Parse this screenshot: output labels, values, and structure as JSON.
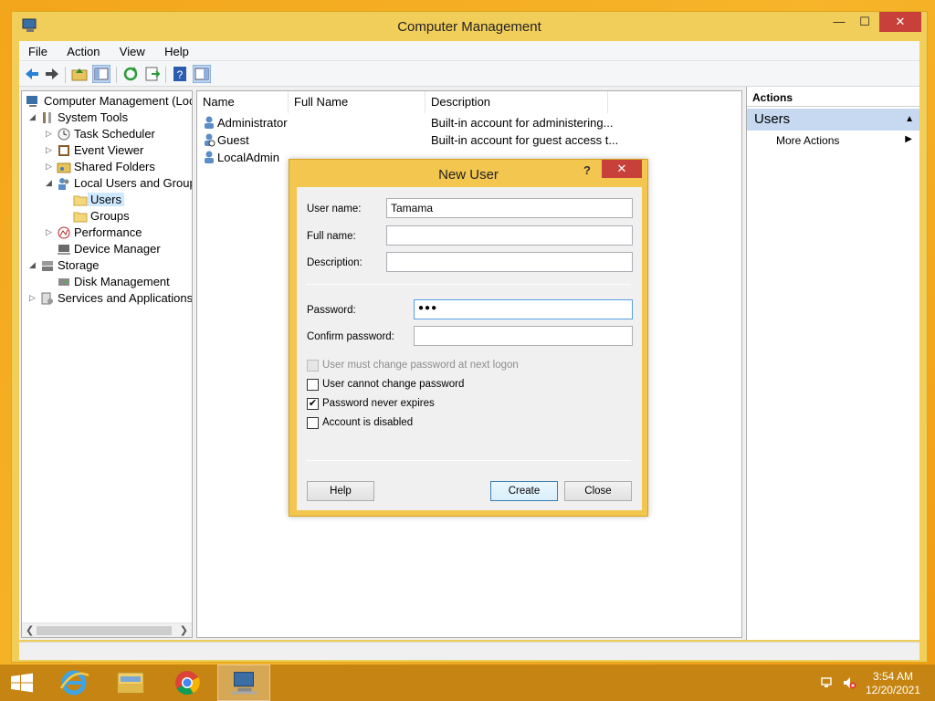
{
  "window": {
    "title": "Computer Management",
    "min": "—",
    "max": "☐",
    "close": "✕"
  },
  "menu": [
    "File",
    "Action",
    "View",
    "Help"
  ],
  "tree": [
    {
      "label": "Computer Management (Local",
      "arrow": "",
      "icon": "computer-management-icon"
    },
    {
      "label": "System Tools",
      "arrow": "◢",
      "icon": "tools-icon"
    },
    {
      "label": "Task Scheduler",
      "arrow": "▷",
      "icon": "clock-icon"
    },
    {
      "label": "Event Viewer",
      "arrow": "▷",
      "icon": "event-viewer-icon"
    },
    {
      "label": "Shared Folders",
      "arrow": "▷",
      "icon": "shared-folder-icon"
    },
    {
      "label": "Local Users and Groups",
      "arrow": "◢",
      "icon": "users-groups-icon"
    },
    {
      "label": "Users",
      "arrow": "",
      "icon": "folder-icon"
    },
    {
      "label": "Groups",
      "arrow": "",
      "icon": "folder-icon"
    },
    {
      "label": "Performance",
      "arrow": "▷",
      "icon": "performance-icon"
    },
    {
      "label": "Device Manager",
      "arrow": "",
      "icon": "device-manager-icon"
    },
    {
      "label": "Storage",
      "arrow": "◢",
      "icon": "storage-icon"
    },
    {
      "label": "Disk Management",
      "arrow": "",
      "icon": "disk-icon"
    },
    {
      "label": "Services and Applications",
      "arrow": "▷",
      "icon": "services-icon"
    }
  ],
  "list": {
    "columns": [
      "Name",
      "Full Name",
      "Description"
    ],
    "rows": [
      {
        "name": "Administrator",
        "full_name": "",
        "description": "Built-in account for administering..."
      },
      {
        "name": "Guest",
        "full_name": "",
        "description": "Built-in account for guest access t..."
      },
      {
        "name": "LocalAdmin",
        "full_name": "",
        "description": ""
      }
    ]
  },
  "actions": {
    "header": "Actions",
    "section": "Users",
    "more": "More Actions"
  },
  "dialog": {
    "title": "New User",
    "help_glyph": "?",
    "close_glyph": "✕",
    "user_name_label": "User name:",
    "user_name_value": "Tamama",
    "full_name_label": "Full name:",
    "full_name_value": "",
    "description_label": "Description:",
    "description_value": "",
    "password_label": "Password:",
    "password_value": "●●●",
    "confirm_label": "Confirm password:",
    "confirm_value": "",
    "checkboxes": [
      {
        "label": "User must change password at next logon",
        "checked": false,
        "disabled": true
      },
      {
        "label": "User cannot change password",
        "checked": false,
        "disabled": false
      },
      {
        "label": "Password never expires",
        "checked": true,
        "disabled": false
      },
      {
        "label": "Account is disabled",
        "checked": false,
        "disabled": false
      }
    ],
    "help_button": "Help",
    "create_button": "Create",
    "close_button": "Close"
  },
  "taskbar": {
    "time": "3:54 AM",
    "date": "12/20/2021"
  }
}
